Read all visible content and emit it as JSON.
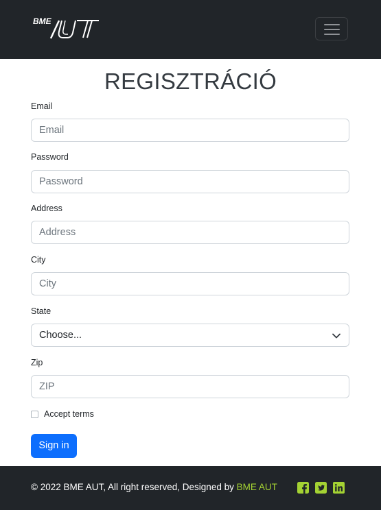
{
  "header": {
    "logo_text": "BME AUT",
    "menu_toggle": "menu"
  },
  "page": {
    "title": "REGISZTRÁCIÓ"
  },
  "form": {
    "email": {
      "label": "Email",
      "placeholder": "Email"
    },
    "password": {
      "label": "Password",
      "placeholder": "Password"
    },
    "address": {
      "label": "Address",
      "placeholder": "Address"
    },
    "city": {
      "label": "City",
      "placeholder": "City"
    },
    "state": {
      "label": "State",
      "selected": "Choose..."
    },
    "zip": {
      "label": "Zip",
      "placeholder": "ZIP"
    },
    "terms_label": "Accept terms",
    "submit_label": "Sign in"
  },
  "footer": {
    "copyright": "© 2022 BME AUT, All right reserved, Designed by ",
    "designer": "BME AUT",
    "social_icons": [
      "facebook-square-icon",
      "twitter-square-icon",
      "linkedin-icon"
    ]
  },
  "colors": {
    "navbar": "#212529",
    "primary": "#0d6efd",
    "footer_link": "#a4d233"
  }
}
